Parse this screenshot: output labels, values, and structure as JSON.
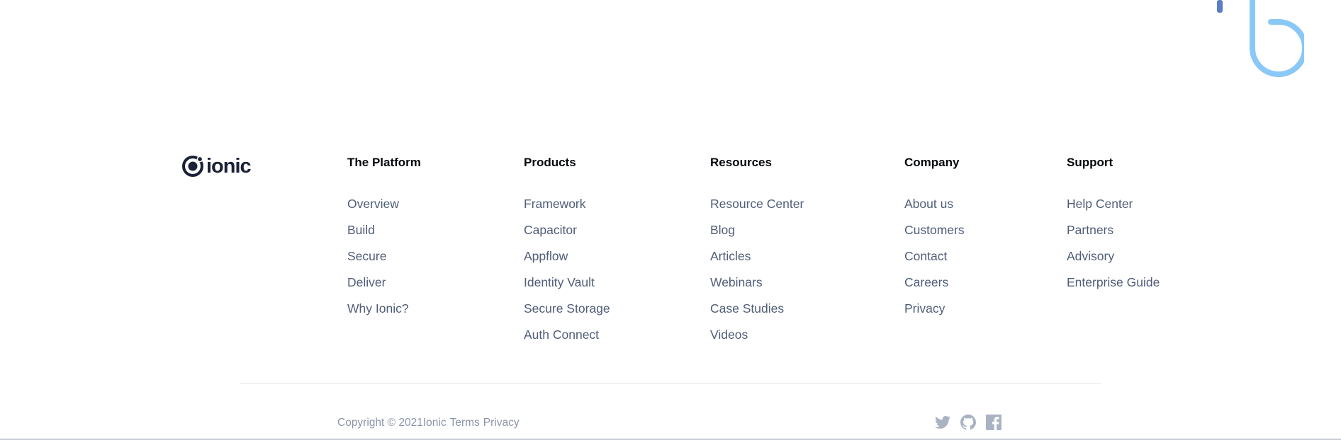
{
  "brand": {
    "logo_text": "ionic"
  },
  "columns": [
    {
      "title": "The Platform",
      "links": [
        "Overview",
        "Build",
        "Secure",
        "Deliver",
        "Why Ionic?"
      ]
    },
    {
      "title": "Products",
      "links": [
        "Framework",
        "Capacitor",
        "Appflow",
        "Identity Vault",
        "Secure Storage",
        "Auth Connect"
      ]
    },
    {
      "title": "Resources",
      "links": [
        "Resource Center",
        "Blog",
        "Articles",
        "Webinars",
        "Case Studies",
        "Videos"
      ]
    },
    {
      "title": "Company",
      "links": [
        "About us",
        "Customers",
        "Contact",
        "Careers",
        "Privacy"
      ]
    },
    {
      "title": "Support",
      "links": [
        "Help Center",
        "Partners",
        "Advisory",
        "Enterprise Guide"
      ]
    }
  ],
  "legal": {
    "copyright": "Copyright © 2021Ionic",
    "terms": "Terms",
    "privacy": "Privacy"
  },
  "social": [
    "twitter-icon",
    "github-icon",
    "facebook-icon"
  ],
  "colors": {
    "heading": "#03060b",
    "link": "#4f5d78",
    "muted": "#8b95a8",
    "accent_blue": "#8ac8f7",
    "brand_dark": "#1a2138"
  }
}
